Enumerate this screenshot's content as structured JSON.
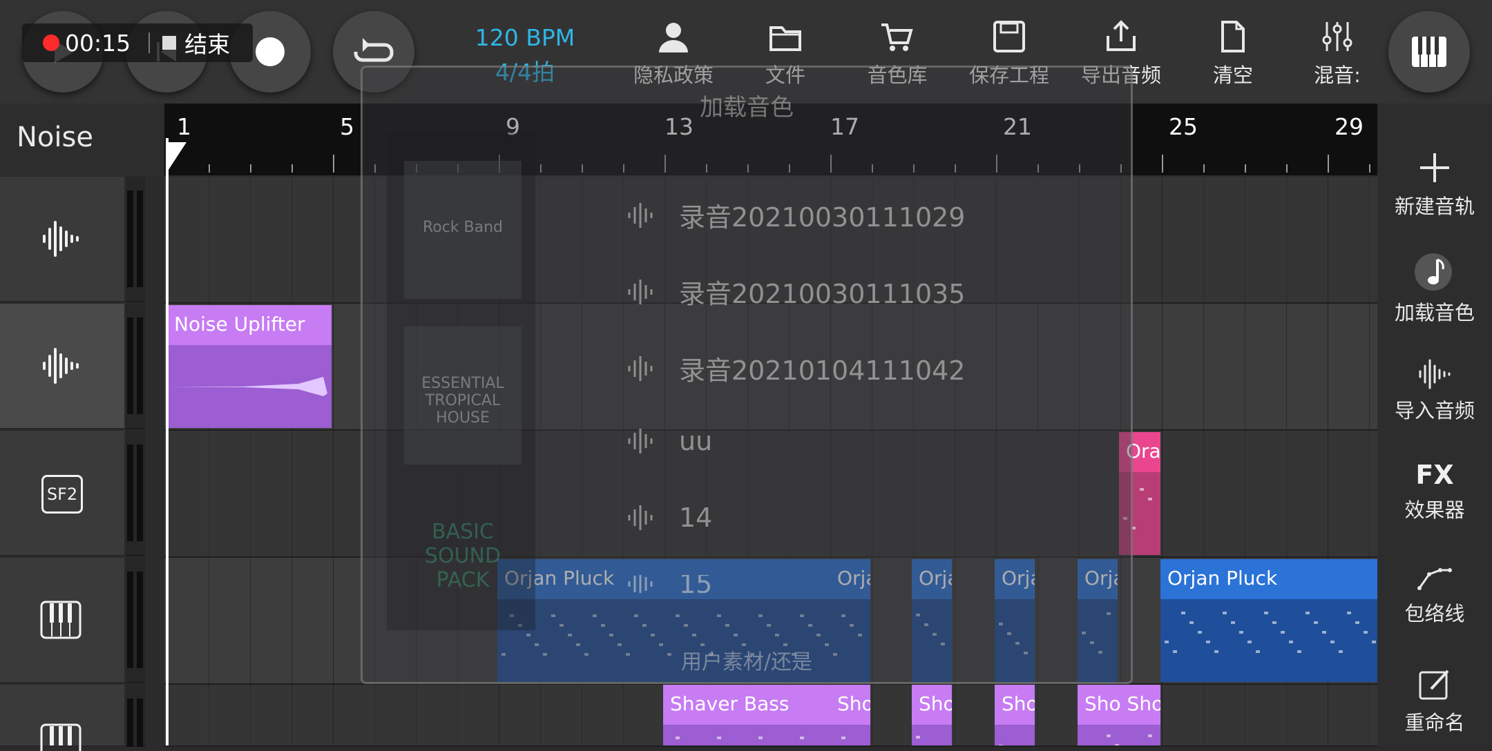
{
  "header": {
    "rec_time": "00:15",
    "end_label": "结束",
    "bpm": "120 BPM",
    "time_signature": "4/4拍",
    "tools": [
      {
        "label": "隐私政策",
        "icon": "user-icon"
      },
      {
        "label": "文件",
        "icon": "folder-icon"
      },
      {
        "label": "音色库",
        "icon": "cart-icon"
      },
      {
        "label": "保存工程",
        "icon": "save-icon"
      },
      {
        "label": "导出音频",
        "icon": "share-icon"
      },
      {
        "label": "清空",
        "icon": "document-icon"
      },
      {
        "label": "混音:",
        "icon": "mixer-sliders-icon"
      }
    ]
  },
  "track_header": {
    "name": "Noise"
  },
  "ruler": {
    "bars": [
      "1",
      "5",
      "9",
      "13",
      "17",
      "21",
      "25",
      "29"
    ]
  },
  "tracks": [
    {
      "type": "audio",
      "icon": "waveform-icon"
    },
    {
      "type": "audio",
      "icon": "waveform-icon",
      "active": true
    },
    {
      "type": "sf2",
      "icon": "sf2-icon",
      "label": "SF2"
    },
    {
      "type": "midi",
      "icon": "piano-icon"
    },
    {
      "type": "midi",
      "icon": "piano-icon"
    }
  ],
  "clips": {
    "noise_uplifter": "Noise Uplifter",
    "orjan_pluck": "Orjan Pluck",
    "orjan_short": "Orja",
    "orjan_short2": "Orja",
    "orjan_short3": "Orja",
    "orjan_short4": "Orja",
    "orjan_pluck_2": "Orjan Pluck",
    "pink_short": "Ora",
    "shaver_bass": "Shaver Bass",
    "sho1": "Sho",
    "sho2": "Sho",
    "sho3": "Sho",
    "sho4": "Sho Sho"
  },
  "sidebar": [
    {
      "label": "新建音轨",
      "icon": "plus-icon"
    },
    {
      "label": "加载音色",
      "icon": "music-note-icon"
    },
    {
      "label": "导入音频",
      "icon": "waveform-icon"
    },
    {
      "label": "效果器",
      "icon": "fx-icon",
      "text": "FX"
    },
    {
      "label": "包络线",
      "icon": "envelope-icon"
    },
    {
      "label": "重命名",
      "icon": "edit-icon"
    }
  ],
  "dialog": {
    "title": "加载音色",
    "packs": [
      "Rock Band",
      "ESSENTIAL TROPICAL HOUSE",
      "BASIC SOUND PACK"
    ],
    "files": [
      "录音20210030111029",
      "录音20210030111035",
      "录音20210104111042",
      "uu",
      "14",
      "15"
    ],
    "footer": "用户素材/还是"
  },
  "colors": {
    "accent": "#2fb6e6",
    "record": "#ff2a2a",
    "clip_purple": "#c77cf3",
    "clip_blue": "#2b73d6",
    "clip_pink": "#e9468f"
  }
}
